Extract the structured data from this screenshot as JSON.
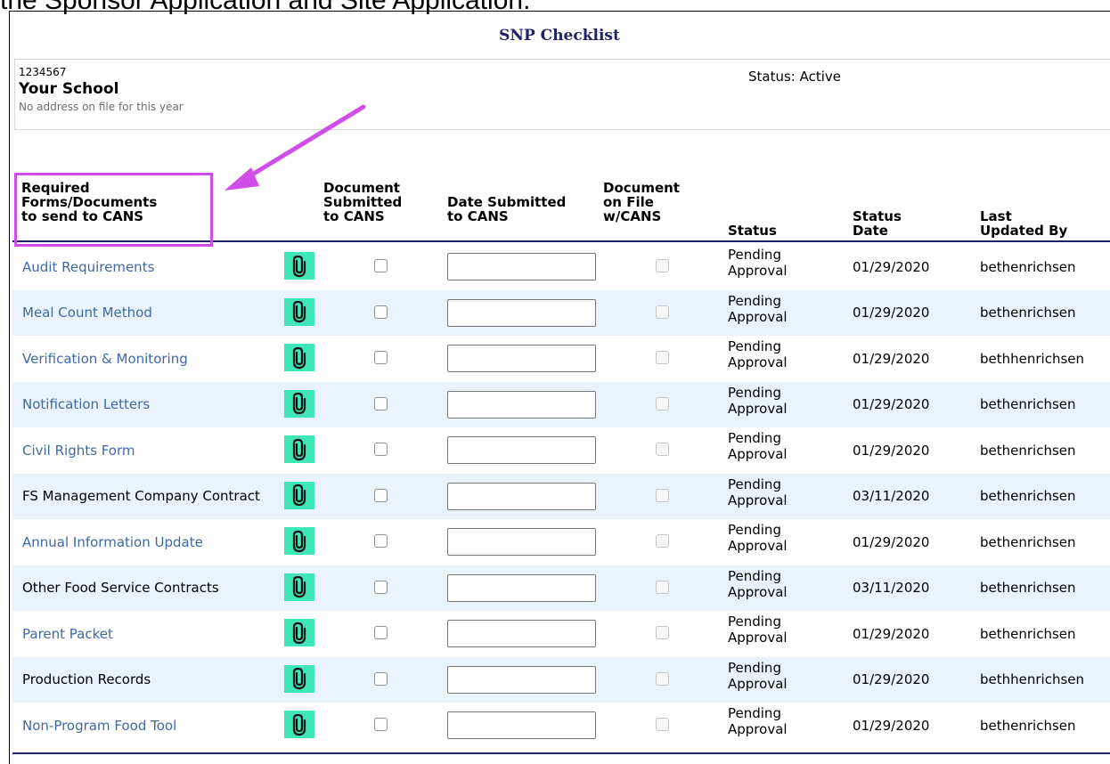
{
  "header_clip": "the Sponsor Application and Site Application.",
  "title": "SNP Checklist",
  "site": {
    "id": "1234567",
    "status": "Status: Active",
    "name": "Your School",
    "address": "No address on file for this year"
  },
  "columns": {
    "required": [
      "Required",
      "Forms/Documents",
      "to send to CANS"
    ],
    "doc_submitted": [
      "Document",
      "Submitted",
      "to CANS"
    ],
    "date_submitted": [
      "Date Submitted",
      "to CANS"
    ],
    "doc_on_file": [
      "Document",
      "on File",
      "w/CANS"
    ],
    "status": [
      "Status"
    ],
    "status_date": [
      "Status",
      "Date"
    ],
    "last_updated": [
      "Last",
      "Updated By"
    ]
  },
  "rows": [
    {
      "name": "Audit Requirements",
      "link": true,
      "status": "Pending Approval",
      "status_date": "01/29/2020",
      "updated_by": "bethenrichsen"
    },
    {
      "name": "Meal Count Method",
      "link": true,
      "status": "Pending Approval",
      "status_date": "01/29/2020",
      "updated_by": "bethenrichsen"
    },
    {
      "name": "Verification & Monitoring",
      "link": true,
      "status": "Pending Approval",
      "status_date": "01/29/2020",
      "updated_by": "bethhenrichsen"
    },
    {
      "name": "Notification Letters",
      "link": true,
      "status": "Pending Approval",
      "status_date": "01/29/2020",
      "updated_by": "bethenrichsen"
    },
    {
      "name": "Civil Rights Form",
      "link": true,
      "status": "Pending Approval",
      "status_date": "01/29/2020",
      "updated_by": "bethenrichsen"
    },
    {
      "name": "FS Management Company Contract",
      "link": false,
      "status": "Pending Approval",
      "status_date": "03/11/2020",
      "updated_by": "bethenrichsen"
    },
    {
      "name": "Annual Information Update",
      "link": true,
      "status": "Pending Approval",
      "status_date": "01/29/2020",
      "updated_by": "bethenrichsen"
    },
    {
      "name": "Other Food Service Contracts",
      "link": false,
      "status": "Pending Approval",
      "status_date": "03/11/2020",
      "updated_by": "bethenrichsen"
    },
    {
      "name": "Parent Packet",
      "link": true,
      "status": "Pending Approval",
      "status_date": "01/29/2020",
      "updated_by": "bethenrichsen"
    },
    {
      "name": "Production Records",
      "link": false,
      "status": "Pending Approval",
      "status_date": "01/29/2020",
      "updated_by": "bethhenrichsen"
    },
    {
      "name": "Non-Program Food Tool",
      "link": true,
      "status": "Pending Approval",
      "status_date": "01/29/2020",
      "updated_by": "bethenrichsen"
    }
  ],
  "colors": {
    "title": "#1f2366",
    "link": "#3f69a4",
    "row_alt": "#eaf3fb",
    "attach_bg": "#3ee6b8",
    "highlight": "#cf4de8"
  },
  "icons": {
    "attach": "paperclip-icon",
    "annotation": "arrow-annotation"
  }
}
